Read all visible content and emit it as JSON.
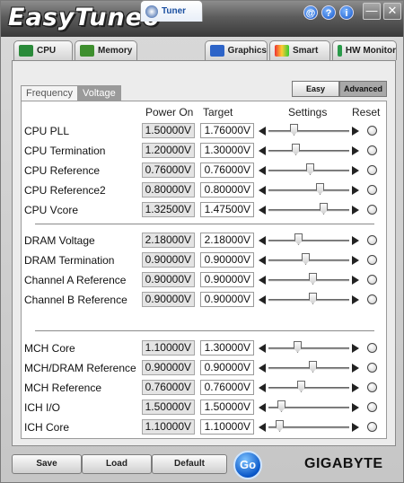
{
  "app": {
    "title": "EasyTune6"
  },
  "titlebar_buttons": [
    {
      "icon": "at-icon",
      "glyph": "@"
    },
    {
      "icon": "help-icon",
      "glyph": "?"
    },
    {
      "icon": "info-icon",
      "glyph": "i"
    }
  ],
  "window_buttons": {
    "minimize": "—",
    "close": "✕"
  },
  "tabs": [
    {
      "label": "CPU",
      "icon": "cpu-icon",
      "active": false
    },
    {
      "label": "Memory",
      "icon": "memory-icon",
      "active": false
    },
    {
      "label": "Tuner",
      "icon": "tuner-icon",
      "active": true
    },
    {
      "label": "Graphics",
      "icon": "graphics-icon",
      "active": false
    },
    {
      "label": "Smart",
      "icon": "smart-icon",
      "active": false
    },
    {
      "label": "HW Monitor",
      "icon": "hw-monitor-icon",
      "active": false
    }
  ],
  "subtabs": {
    "frequency": "Frequency",
    "voltage": "Voltage"
  },
  "mode": {
    "easy": "Easy",
    "advanced": "Advanced",
    "selected": "Advanced"
  },
  "headers": {
    "power_on": "Power On",
    "target": "Target",
    "settings": "Settings",
    "reset": "Reset"
  },
  "groups": [
    {
      "rows": [
        {
          "label": "CPU PLL",
          "power_on": "1.50000V",
          "target": "1.76000V",
          "slider": 0.3
        },
        {
          "label": "CPU Termination",
          "power_on": "1.20000V",
          "target": "1.30000V",
          "slider": 0.32
        },
        {
          "label": "CPU Reference",
          "power_on": "0.76000V",
          "target": "0.76000V",
          "slider": 0.52
        },
        {
          "label": "CPU Reference2",
          "power_on": "0.80000V",
          "target": "0.80000V",
          "slider": 0.66
        },
        {
          "label": "CPU Vcore",
          "power_on": "1.32500V",
          "target": "1.47500V",
          "slider": 0.7
        }
      ]
    },
    {
      "rows": [
        {
          "label": "DRAM Voltage",
          "power_on": "2.18000V",
          "target": "2.18000V",
          "slider": 0.36
        },
        {
          "label": "DRAM Termination",
          "power_on": "0.90000V",
          "target": "0.90000V",
          "slider": 0.46
        },
        {
          "label": "Channel A Reference",
          "power_on": "0.90000V",
          "target": "0.90000V",
          "slider": 0.56
        },
        {
          "label": "Channel B Reference",
          "power_on": "0.90000V",
          "target": "0.90000V",
          "slider": 0.56
        }
      ]
    },
    {
      "rows": [
        {
          "label": "MCH Core",
          "power_on": "1.10000V",
          "target": "1.30000V",
          "slider": 0.34
        },
        {
          "label": "MCH/DRAM Reference",
          "power_on": "0.90000V",
          "target": "0.90000V",
          "slider": 0.56
        },
        {
          "label": "MCH Reference",
          "power_on": "0.76000V",
          "target": "0.76000V",
          "slider": 0.4
        },
        {
          "label": "ICH I/O",
          "power_on": "1.50000V",
          "target": "1.50000V",
          "slider": 0.12
        },
        {
          "label": "ICH Core",
          "power_on": "1.10000V",
          "target": "1.10000V",
          "slider": 0.1
        }
      ]
    }
  ],
  "bottom": {
    "save": "Save",
    "load": "Load",
    "default": "Default",
    "go": "Go"
  },
  "brand": "GIGABYTE",
  "colors": {
    "accent": "#1456c9",
    "titlebar": "#4a4a4a",
    "voltage_tab": "#9a9a9a",
    "advanced_btn": "#a8a8a8"
  }
}
